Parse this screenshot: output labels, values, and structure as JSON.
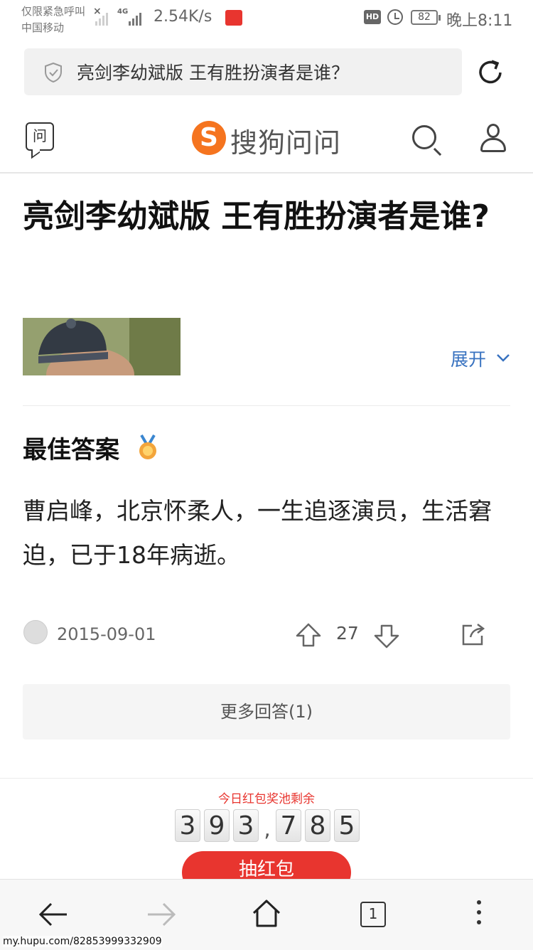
{
  "status_bar": {
    "carrier_line1": "仅限紧急呼叫",
    "carrier_line2": "中国移动",
    "network_type": "4G",
    "speed": "2.54K/s",
    "hd_badge": "HD",
    "battery": "82",
    "time": "晚上8:11"
  },
  "browser": {
    "url_text": "亮剑李幼斌版 王有胜扮演者是谁？",
    "tabs_count": "1"
  },
  "site": {
    "ask_icon_label": "问",
    "logo_letter": "S",
    "logo_text": "搜狗问问"
  },
  "question": {
    "title": "亮剑李幼斌版 王有胜扮演者是谁?",
    "expand_label": "展开"
  },
  "answer": {
    "label": "最佳答案",
    "text": "曹启峰，北京怀柔人，一生追逐演员，生活窘迫，已于18年病逝。",
    "date": "2015-09-01",
    "votes": "27"
  },
  "more_answers": "更多回答(1)",
  "lottery": {
    "pool_label": "今日红包奖池剩余",
    "digits_a": [
      "3",
      "9",
      "3"
    ],
    "digits_b": [
      "7",
      "8",
      "5"
    ],
    "button": "抽红包"
  },
  "watermark": "my.hupu.com/82853999332909",
  "colors": {
    "accent_orange": "#f5741f",
    "link_blue": "#3872c0",
    "lottery_red": "#e8352f"
  }
}
